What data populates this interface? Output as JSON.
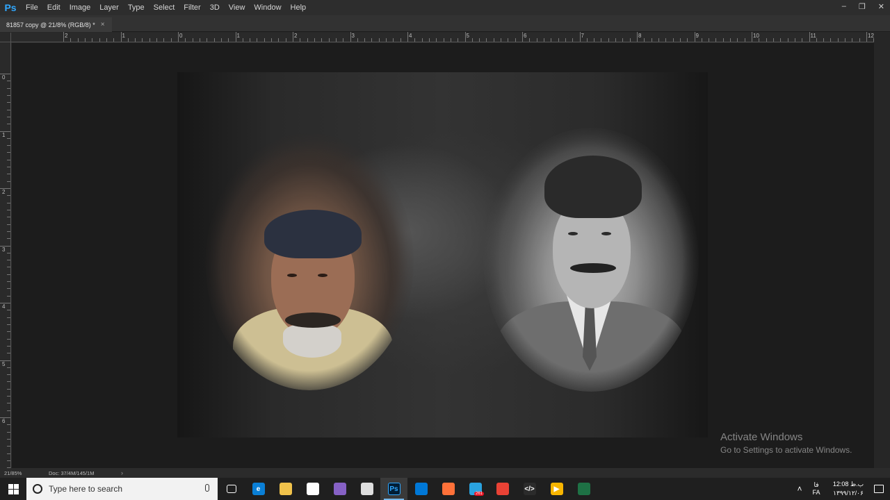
{
  "app": {
    "logo": "Ps"
  },
  "menu": [
    "File",
    "Edit",
    "Image",
    "Layer",
    "Type",
    "Select",
    "Filter",
    "3D",
    "View",
    "Window",
    "Help"
  ],
  "window_controls": {
    "minimize": "–",
    "restore": "❐",
    "close": "✕"
  },
  "document_tab": {
    "title": "81857 copy @ 21/8% (RGB/8) *",
    "close": "×"
  },
  "ruler_h": [
    "2",
    "1",
    "0",
    "1",
    "2",
    "3",
    "4",
    "5",
    "6",
    "7",
    "8",
    "9",
    "10",
    "11",
    "12"
  ],
  "ruler_v": [
    "0",
    "1",
    "2",
    "3",
    "4",
    "5",
    "6"
  ],
  "status": {
    "zoom": "21/85%",
    "doc": "Doc: 37/4M/145/1M",
    "arrow": "›"
  },
  "watermark": {
    "line1": "Activate Windows",
    "line2": "Go to Settings to activate Windows."
  },
  "taskbar": {
    "search_placeholder": "Type here to search",
    "icons": [
      {
        "name": "task-view-icon",
        "label": "",
        "color": "#1f1f1f"
      },
      {
        "name": "edge-icon",
        "label": "e",
        "color": "#0a7fd6"
      },
      {
        "name": "file-explorer-icon",
        "label": "",
        "color": "#f0c24b"
      },
      {
        "name": "store-icon",
        "label": "",
        "color": "#ffffff"
      },
      {
        "name": "visual-studio-icon",
        "label": "",
        "color": "#8661c5"
      },
      {
        "name": "mail-icon",
        "label": "",
        "color": "#dddddd"
      },
      {
        "name": "photoshop-icon",
        "label": "Ps",
        "color": "#001e36"
      },
      {
        "name": "bluetooth-icon",
        "label": "",
        "color": "#0078d7"
      },
      {
        "name": "firefox-icon",
        "label": "",
        "color": "#ff7139"
      },
      {
        "name": "telegram-icon",
        "label": "",
        "color": "#2aa3e0"
      },
      {
        "name": "chrome-icon",
        "label": "",
        "color": "#e94235"
      },
      {
        "name": "code-editor-icon",
        "label": "</>",
        "color": "#2b2b2b"
      },
      {
        "name": "media-player-icon",
        "label": "▶",
        "color": "#f7b500"
      },
      {
        "name": "spreadsheet-icon",
        "label": "",
        "color": "#1e7145"
      }
    ],
    "telegram_badge": "261",
    "tray": {
      "chevron": "˄",
      "lang_top": "فا",
      "lang_bottom": "FA",
      "time": "12:08 ب.ظ",
      "date": "۱۳۹۹/۱۲/۰۶"
    }
  }
}
